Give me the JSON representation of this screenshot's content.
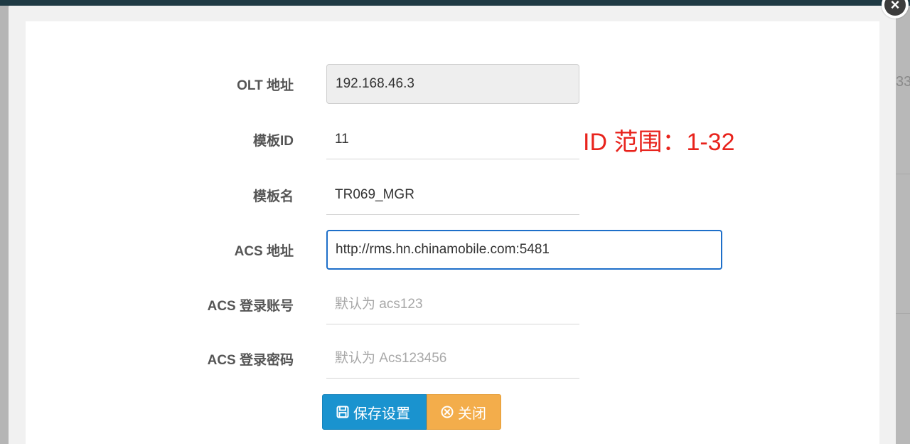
{
  "background": {
    "right_edge_text": "33"
  },
  "form": {
    "olt_address": {
      "label": "OLT 地址",
      "value": "192.168.46.3"
    },
    "template_id": {
      "label": "模板ID",
      "value": "11",
      "hint": "ID 范围：1-32"
    },
    "template_name": {
      "label": "模板名",
      "value": "TR069_MGR"
    },
    "acs_address": {
      "label": "ACS 地址",
      "value": "http://rms.hn.chinamobile.com:5481"
    },
    "acs_account": {
      "label": "ACS 登录账号",
      "value": "",
      "placeholder": "默认为 acs123"
    },
    "acs_password": {
      "label": "ACS 登录密码",
      "value": "",
      "placeholder": "默认为 Acs123456"
    }
  },
  "buttons": {
    "save": {
      "label": "保存设置",
      "icon": "save-icon"
    },
    "close": {
      "label": "关闭",
      "icon": "close-circle-icon"
    }
  },
  "modal_close": {
    "glyph": "×",
    "icon": "close-icon"
  },
  "colors": {
    "primary": "#1a93cf",
    "warning": "#f3ad4b",
    "hint": "#e8231c",
    "focus_border": "#1e6fc9"
  }
}
